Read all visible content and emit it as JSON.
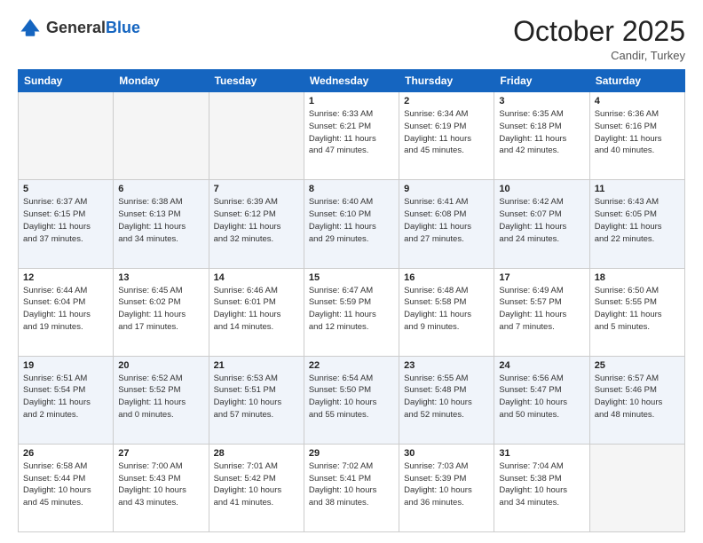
{
  "header": {
    "logo_line1": "General",
    "logo_line2": "Blue",
    "month": "October 2025",
    "location": "Candir, Turkey"
  },
  "days_of_week": [
    "Sunday",
    "Monday",
    "Tuesday",
    "Wednesday",
    "Thursday",
    "Friday",
    "Saturday"
  ],
  "weeks": [
    [
      {
        "day": "",
        "info": ""
      },
      {
        "day": "",
        "info": ""
      },
      {
        "day": "",
        "info": ""
      },
      {
        "day": "1",
        "info": "Sunrise: 6:33 AM\nSunset: 6:21 PM\nDaylight: 11 hours\nand 47 minutes."
      },
      {
        "day": "2",
        "info": "Sunrise: 6:34 AM\nSunset: 6:19 PM\nDaylight: 11 hours\nand 45 minutes."
      },
      {
        "day": "3",
        "info": "Sunrise: 6:35 AM\nSunset: 6:18 PM\nDaylight: 11 hours\nand 42 minutes."
      },
      {
        "day": "4",
        "info": "Sunrise: 6:36 AM\nSunset: 6:16 PM\nDaylight: 11 hours\nand 40 minutes."
      }
    ],
    [
      {
        "day": "5",
        "info": "Sunrise: 6:37 AM\nSunset: 6:15 PM\nDaylight: 11 hours\nand 37 minutes."
      },
      {
        "day": "6",
        "info": "Sunrise: 6:38 AM\nSunset: 6:13 PM\nDaylight: 11 hours\nand 34 minutes."
      },
      {
        "day": "7",
        "info": "Sunrise: 6:39 AM\nSunset: 6:12 PM\nDaylight: 11 hours\nand 32 minutes."
      },
      {
        "day": "8",
        "info": "Sunrise: 6:40 AM\nSunset: 6:10 PM\nDaylight: 11 hours\nand 29 minutes."
      },
      {
        "day": "9",
        "info": "Sunrise: 6:41 AM\nSunset: 6:08 PM\nDaylight: 11 hours\nand 27 minutes."
      },
      {
        "day": "10",
        "info": "Sunrise: 6:42 AM\nSunset: 6:07 PM\nDaylight: 11 hours\nand 24 minutes."
      },
      {
        "day": "11",
        "info": "Sunrise: 6:43 AM\nSunset: 6:05 PM\nDaylight: 11 hours\nand 22 minutes."
      }
    ],
    [
      {
        "day": "12",
        "info": "Sunrise: 6:44 AM\nSunset: 6:04 PM\nDaylight: 11 hours\nand 19 minutes."
      },
      {
        "day": "13",
        "info": "Sunrise: 6:45 AM\nSunset: 6:02 PM\nDaylight: 11 hours\nand 17 minutes."
      },
      {
        "day": "14",
        "info": "Sunrise: 6:46 AM\nSunset: 6:01 PM\nDaylight: 11 hours\nand 14 minutes."
      },
      {
        "day": "15",
        "info": "Sunrise: 6:47 AM\nSunset: 5:59 PM\nDaylight: 11 hours\nand 12 minutes."
      },
      {
        "day": "16",
        "info": "Sunrise: 6:48 AM\nSunset: 5:58 PM\nDaylight: 11 hours\nand 9 minutes."
      },
      {
        "day": "17",
        "info": "Sunrise: 6:49 AM\nSunset: 5:57 PM\nDaylight: 11 hours\nand 7 minutes."
      },
      {
        "day": "18",
        "info": "Sunrise: 6:50 AM\nSunset: 5:55 PM\nDaylight: 11 hours\nand 5 minutes."
      }
    ],
    [
      {
        "day": "19",
        "info": "Sunrise: 6:51 AM\nSunset: 5:54 PM\nDaylight: 11 hours\nand 2 minutes."
      },
      {
        "day": "20",
        "info": "Sunrise: 6:52 AM\nSunset: 5:52 PM\nDaylight: 11 hours\nand 0 minutes."
      },
      {
        "day": "21",
        "info": "Sunrise: 6:53 AM\nSunset: 5:51 PM\nDaylight: 10 hours\nand 57 minutes."
      },
      {
        "day": "22",
        "info": "Sunrise: 6:54 AM\nSunset: 5:50 PM\nDaylight: 10 hours\nand 55 minutes."
      },
      {
        "day": "23",
        "info": "Sunrise: 6:55 AM\nSunset: 5:48 PM\nDaylight: 10 hours\nand 52 minutes."
      },
      {
        "day": "24",
        "info": "Sunrise: 6:56 AM\nSunset: 5:47 PM\nDaylight: 10 hours\nand 50 minutes."
      },
      {
        "day": "25",
        "info": "Sunrise: 6:57 AM\nSunset: 5:46 PM\nDaylight: 10 hours\nand 48 minutes."
      }
    ],
    [
      {
        "day": "26",
        "info": "Sunrise: 6:58 AM\nSunset: 5:44 PM\nDaylight: 10 hours\nand 45 minutes."
      },
      {
        "day": "27",
        "info": "Sunrise: 7:00 AM\nSunset: 5:43 PM\nDaylight: 10 hours\nand 43 minutes."
      },
      {
        "day": "28",
        "info": "Sunrise: 7:01 AM\nSunset: 5:42 PM\nDaylight: 10 hours\nand 41 minutes."
      },
      {
        "day": "29",
        "info": "Sunrise: 7:02 AM\nSunset: 5:41 PM\nDaylight: 10 hours\nand 38 minutes."
      },
      {
        "day": "30",
        "info": "Sunrise: 7:03 AM\nSunset: 5:39 PM\nDaylight: 10 hours\nand 36 minutes."
      },
      {
        "day": "31",
        "info": "Sunrise: 7:04 AM\nSunset: 5:38 PM\nDaylight: 10 hours\nand 34 minutes."
      },
      {
        "day": "",
        "info": ""
      }
    ]
  ]
}
